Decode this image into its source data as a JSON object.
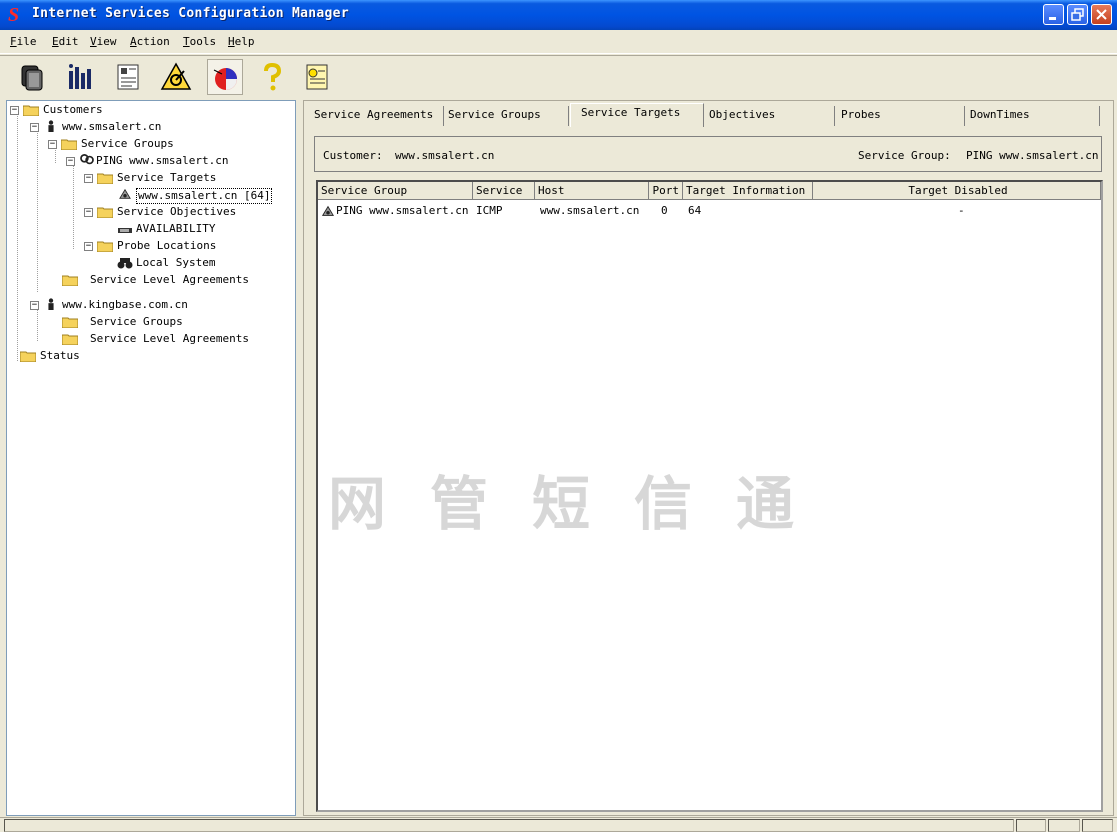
{
  "window": {
    "title": "Internet Services Configuration Manager",
    "app_icon": "app-logo-icon"
  },
  "menu": [
    {
      "label": "File",
      "mnemonic": "F"
    },
    {
      "label": "Edit",
      "mnemonic": "E"
    },
    {
      "label": "View",
      "mnemonic": "V"
    },
    {
      "label": "Action",
      "mnemonic": "A"
    },
    {
      "label": "Tools",
      "mnemonic": "T"
    },
    {
      "label": "Help",
      "mnemonic": "H"
    }
  ],
  "menu_rest": [
    "ile",
    "dit",
    "iew",
    "ction",
    "ools",
    "elp"
  ],
  "toolbar": {
    "buttons": [
      "copy-icon",
      "chart-bars-icon",
      "document-icon",
      "probe-triangle-icon",
      "pie-chart-icon",
      "help-question-icon",
      "notes-icon"
    ]
  },
  "tree": {
    "customers": "Customers",
    "c1": "www.smsalert.cn",
    "c1_groups": "Service Groups",
    "c1_group1": "PING www.smsalert.cn",
    "c1_targets": "Service Targets",
    "c1_target1": "www.smsalert.cn [64]",
    "c1_objectives": "Service Objectives",
    "c1_obj1": "AVAILABILITY",
    "c1_probes": "Probe Locations",
    "c1_probe1": "Local System",
    "c1_sla": "Service Level Agreements",
    "c2": "www.kingbase.com.cn",
    "c2_groups": "Service Groups",
    "c2_sla": "Service Level Agreements",
    "status": "Status"
  },
  "tabs": [
    "Service Agreements",
    "Service Groups",
    "Service Targets",
    "Objectives",
    "Probes",
    "DownTimes"
  ],
  "info": {
    "customer_label": "Customer:",
    "customer_value": "www.smsalert.cn",
    "group_label": "Service Group:",
    "group_value": "PING www.smsalert.cn"
  },
  "grid": {
    "columns": [
      "Service Group",
      "Service",
      "Host",
      "Port",
      "Target Information",
      "Target Disabled"
    ],
    "rows": [
      {
        "group": "PING www.smsalert.cn",
        "service": "ICMP",
        "host": "www.smsalert.cn",
        "port": "0",
        "info": "64",
        "disabled": "-"
      }
    ]
  },
  "watermark": "网管短信通"
}
